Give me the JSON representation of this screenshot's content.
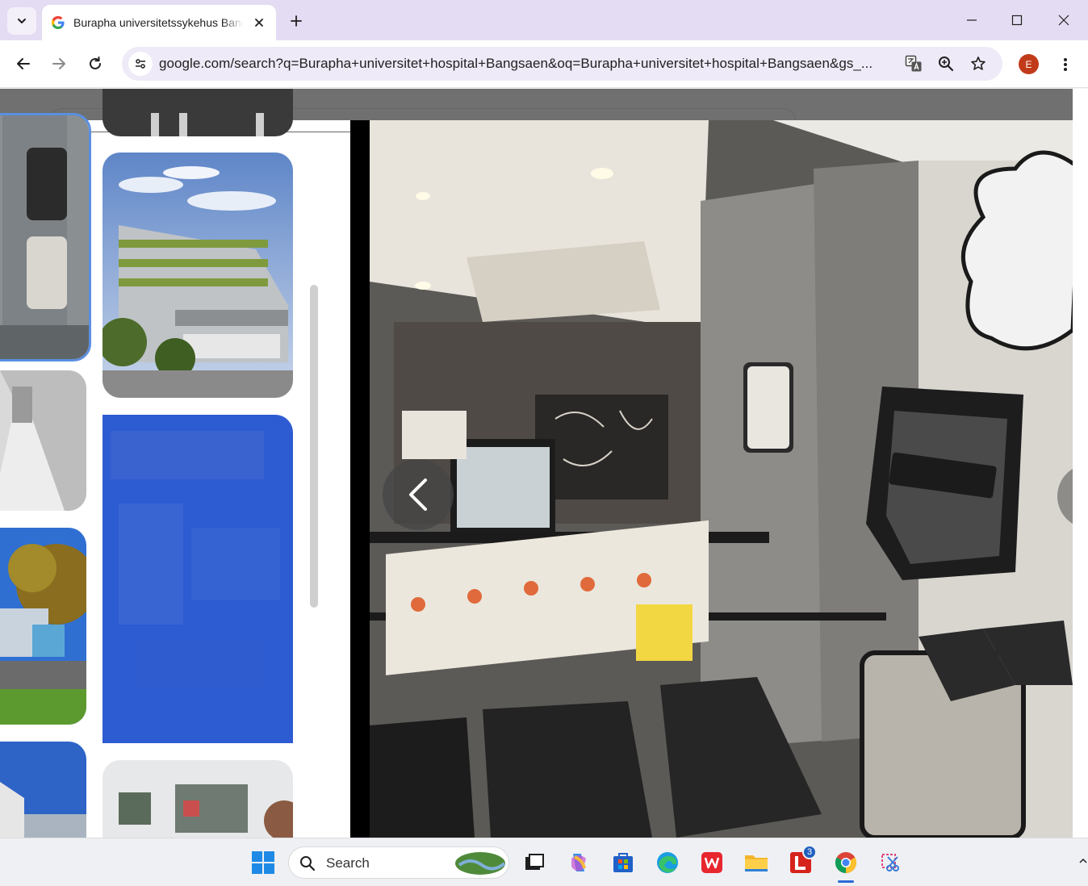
{
  "browser": {
    "tab": {
      "title": "Burapha universitetssykehus Bangsaen - Google Search"
    },
    "address_bar": {
      "url": "google.com/search?q=Burapha+universitet+hospital+Bangsaen&oq=Burapha+universitet+hospital+Bangsaen&gs_..."
    },
    "profile": {
      "initial": "E"
    }
  },
  "taskbar": {
    "search_label": "Search",
    "mail_badge": "3"
  },
  "colors": {
    "tabstrip": "#e3dcf2",
    "omnibox": "#efeaf7",
    "avatar": "#c13b1b",
    "selected_outline": "#5a8fe0"
  }
}
